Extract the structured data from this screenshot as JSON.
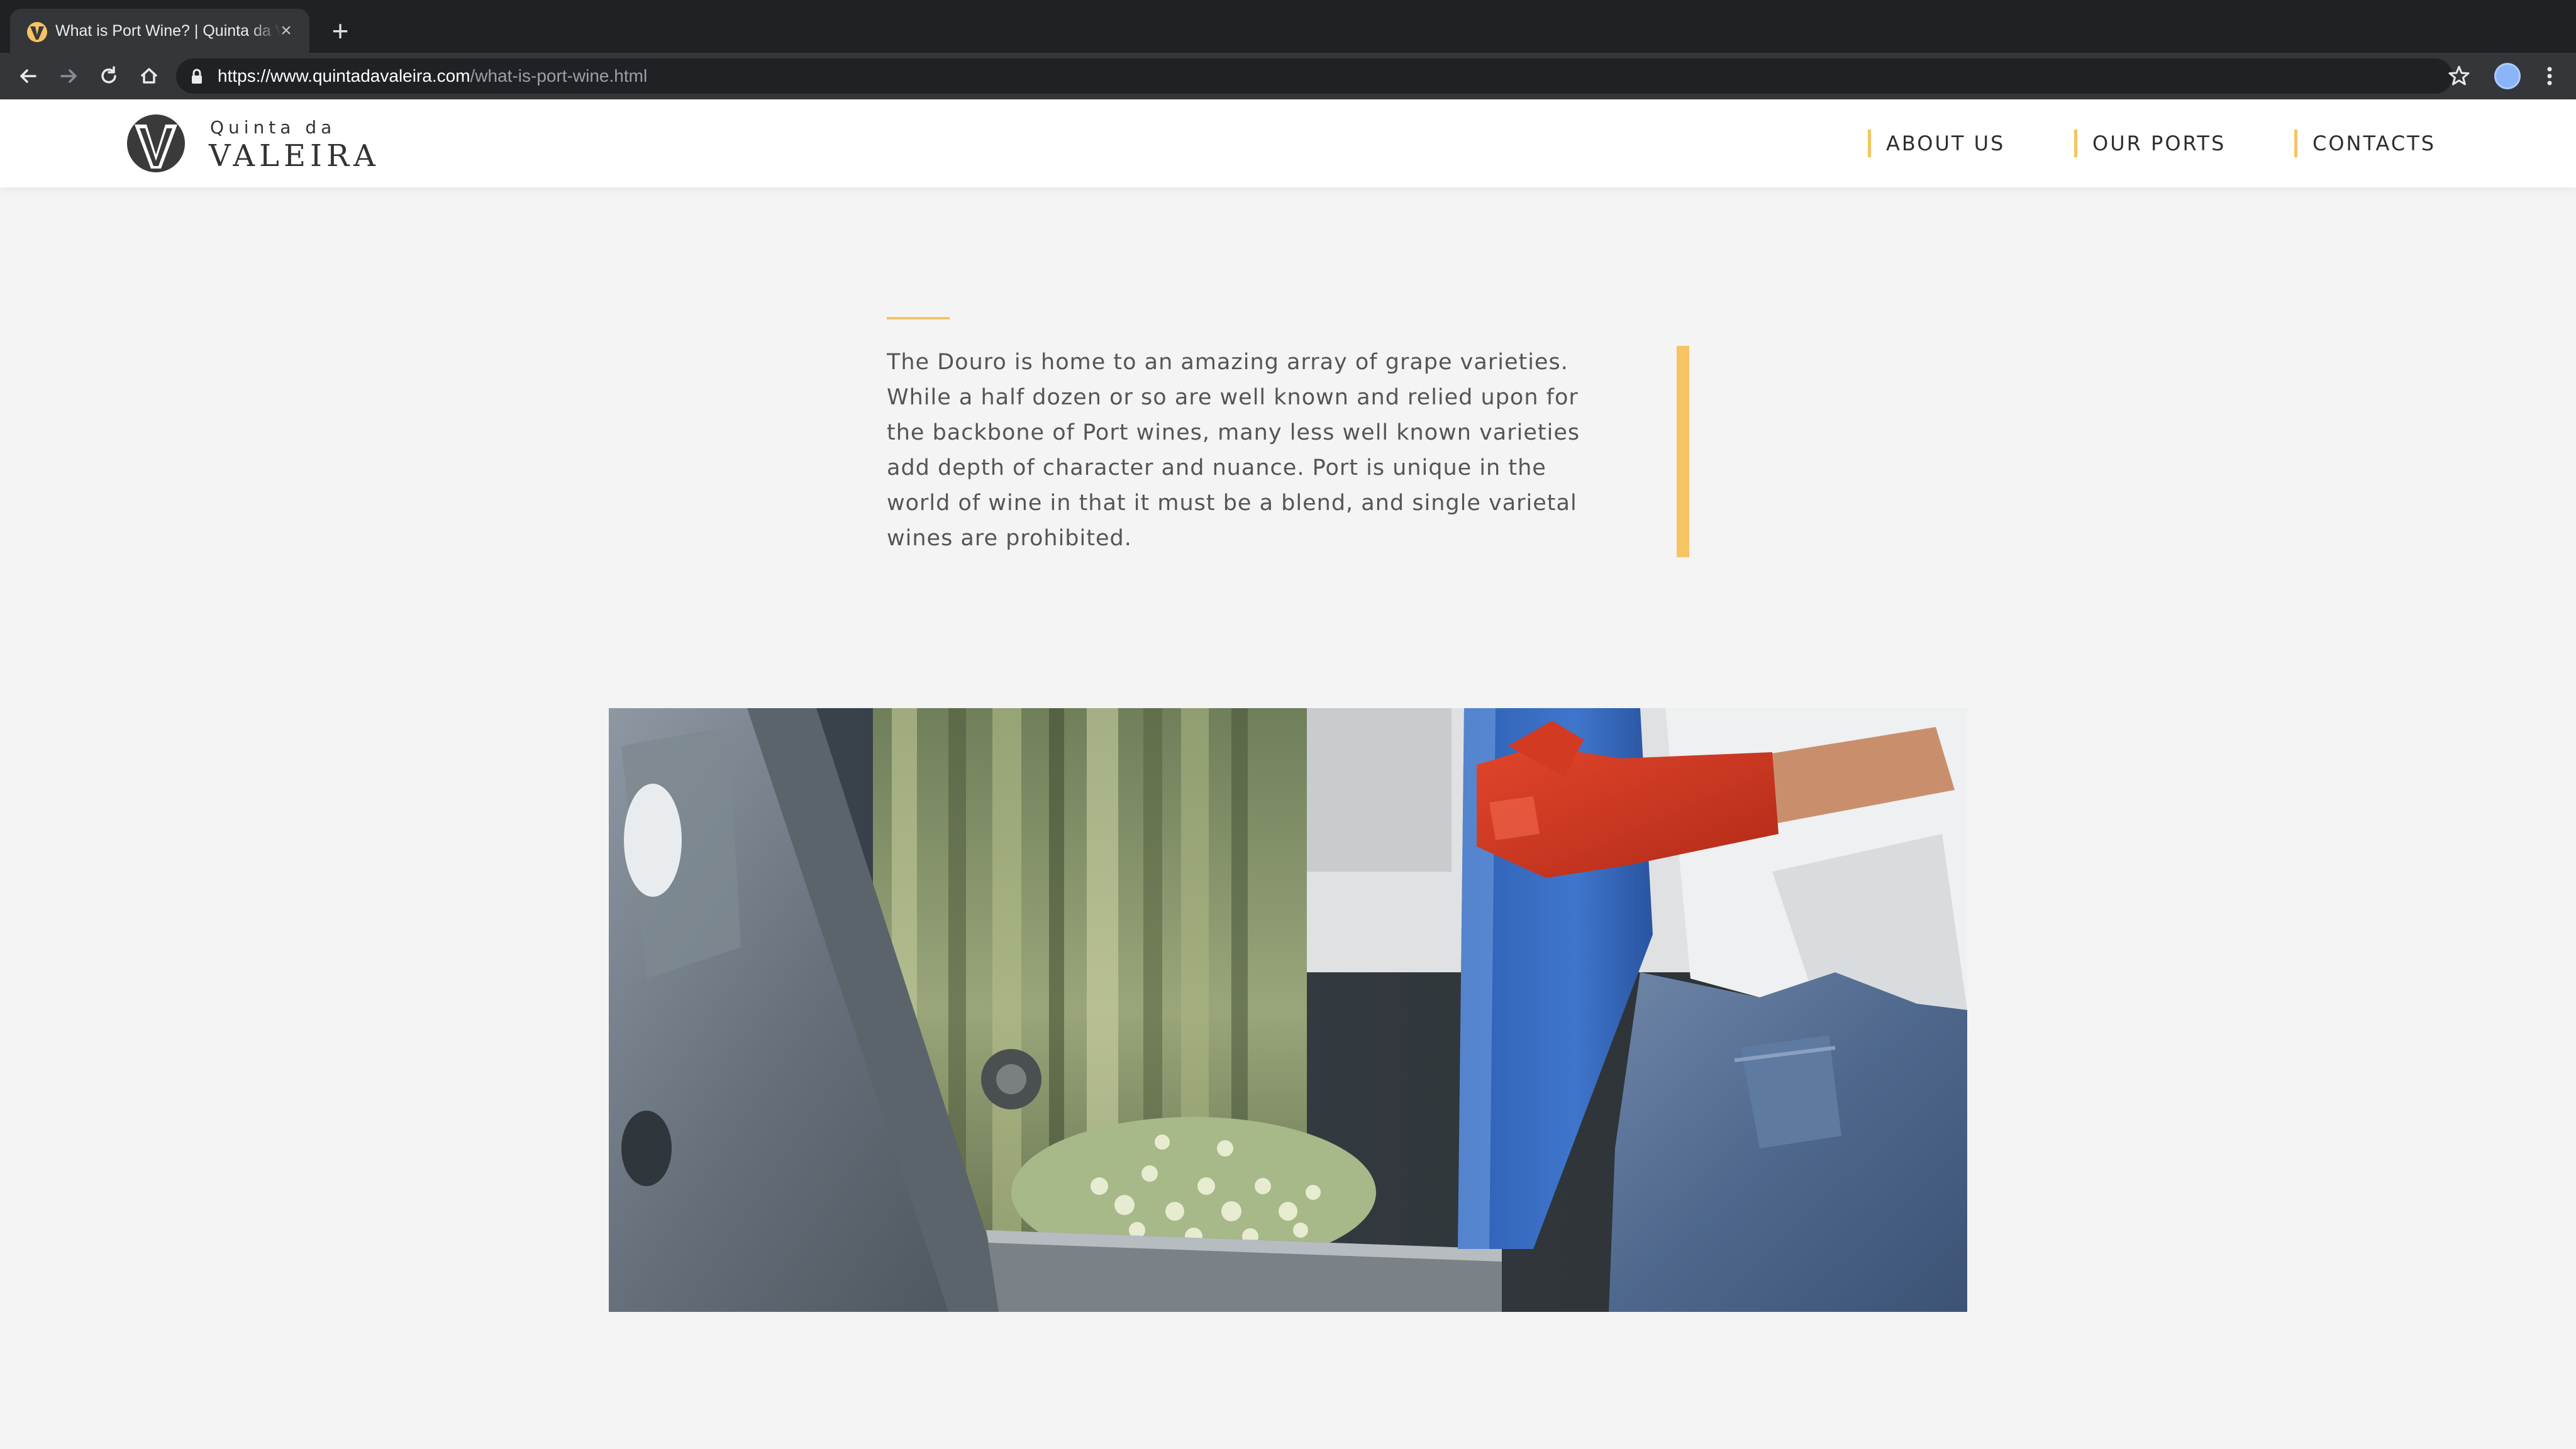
{
  "browser": {
    "tab_title": "What is Port Wine? | Quinta da Valeira",
    "url_host": "https://www.quintadavaleira.com",
    "url_path": "/what-is-port-wine.html",
    "icons": [
      "back-arrow-icon",
      "forward-arrow-icon",
      "reload-icon",
      "home-icon",
      "lock-icon",
      "star-icon",
      "profile-avatar",
      "kebab-menu-icon"
    ]
  },
  "site": {
    "logo_top": "Quinta da",
    "logo_bottom": "VALEIRA",
    "nav": [
      {
        "label": "ABOUT US"
      },
      {
        "label": "OUR PORTS"
      },
      {
        "label": "CONTACTS"
      }
    ],
    "accent_color": "#f6c462"
  },
  "content": {
    "intro": "The Douro is home to an amazing array of grape varieties. While a half dozen or so are well known and relied upon for the backbone of Port wines, many less well known varieties add depth of character and nuance. Port is unique in the world of wine in that it must be a blend, and single varietal wines are prohibited."
  }
}
